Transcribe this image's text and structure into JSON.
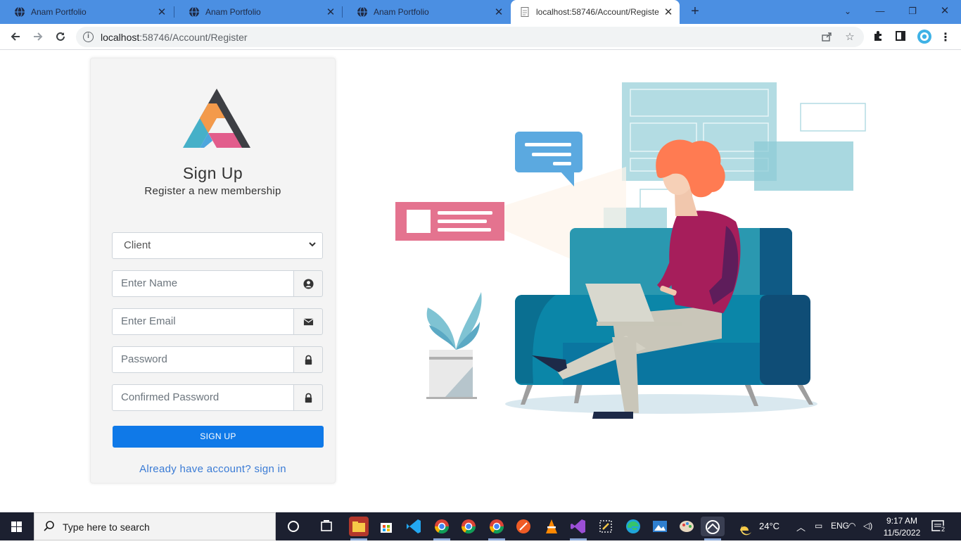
{
  "browser": {
    "tabs": [
      {
        "title": "Anam Portfolio",
        "active": false
      },
      {
        "title": "Anam Portfolio",
        "active": false
      },
      {
        "title": "Anam Portfolio",
        "active": false
      },
      {
        "title": "localhost:58746/Account/Registe",
        "active": true
      }
    ],
    "new_tab_label": "+",
    "url_host": "localhost",
    "url_path": ":58746/Account/Register",
    "window_controls": {
      "minimize": "—",
      "restore": "❐",
      "close": "✕"
    }
  },
  "form": {
    "title": "Sign Up",
    "subtitle": "Register a new membership",
    "role_select": {
      "value": "Client"
    },
    "name_input": {
      "placeholder": "Enter Name",
      "icon": "user-circle-icon"
    },
    "email_input": {
      "placeholder": "Enter Email",
      "icon": "envelope-icon"
    },
    "password_input": {
      "placeholder": "Password",
      "icon": "lock-icon"
    },
    "confirm_password_input": {
      "placeholder": "Confirmed Password",
      "icon": "lock-icon"
    },
    "submit_label": "SIGN UP",
    "signin_link": "Already have account? sign in"
  },
  "colors": {
    "tabstrip": "#4b8fe2",
    "primary_button": "#0f79e8",
    "link": "#3a7bd5",
    "card_bg": "#f4f4f4"
  },
  "taskbar": {
    "search_placeholder": "Type here to search",
    "weather": "24°C",
    "time": "9:17 AM",
    "date": "11/5/2022",
    "language": "ENG",
    "notification_count": "2"
  }
}
